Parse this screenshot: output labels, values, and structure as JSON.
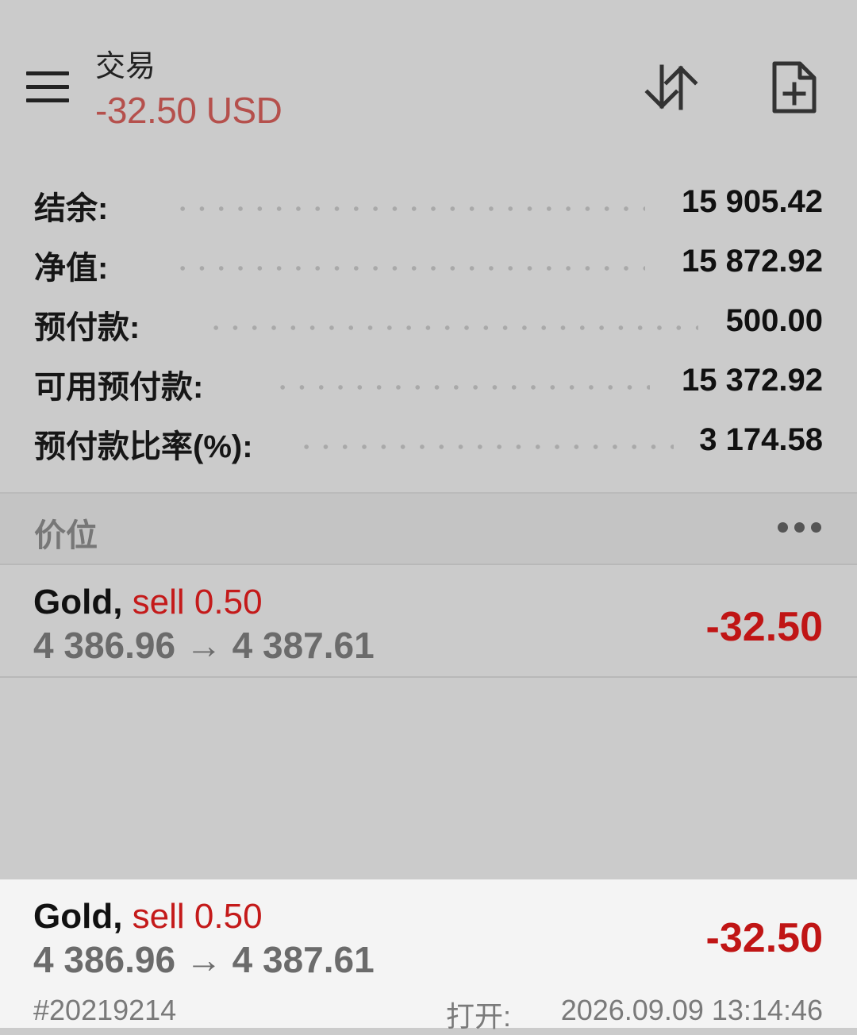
{
  "header": {
    "title": "交易",
    "profit": "-32.50 USD"
  },
  "summary": [
    {
      "label": "结余:",
      "value": "15 905.42"
    },
    {
      "label": "净值:",
      "value": "15 872.92"
    },
    {
      "label": "预付款:",
      "value": "500.00"
    },
    {
      "label": "可用预付款:",
      "value": "15 372.92"
    },
    {
      "label": "预付款比率(%):",
      "value": "3 174.58"
    }
  ],
  "section": {
    "title": "价位"
  },
  "positions": [
    {
      "symbol": "Gold,",
      "type": "sell 0.50",
      "prices": "4 386.96 → 4 387.61",
      "profit": "-32.50"
    },
    {
      "symbol": "Gold,",
      "type": "sell 0.50",
      "prices": "4 386.96 → 4 387.61",
      "profit": "-32.50",
      "ticket": "#20219214",
      "open_label": "打开:",
      "open_time": "2026.09.09 13:14:46"
    }
  ],
  "icons": {
    "menu": "hamburger-menu-icon",
    "sort": "sort-arrows-icon",
    "new_order": "new-document-plus-icon",
    "more": "more-horizontal-icon"
  },
  "colors": {
    "loss": "#c01515",
    "header_profit": "#b5504c"
  }
}
